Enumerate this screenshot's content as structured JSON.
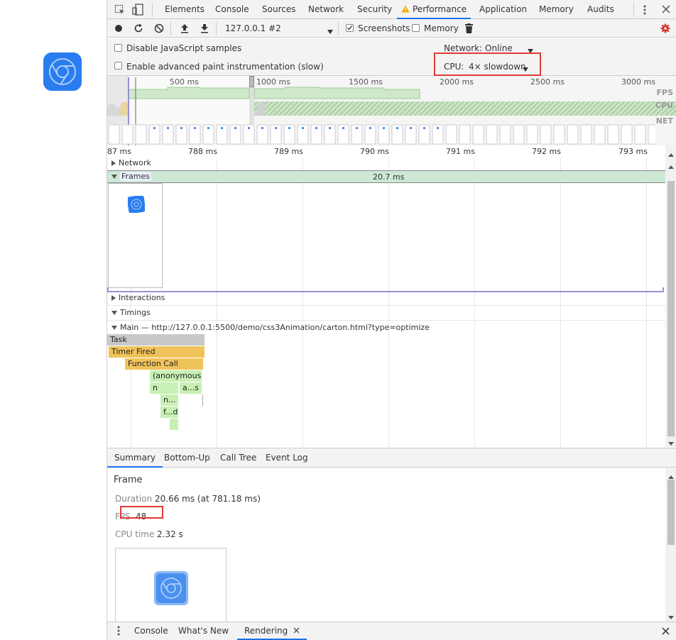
{
  "tabs": [
    "Elements",
    "Console",
    "Sources",
    "Network",
    "Security",
    "Performance",
    "Application",
    "Memory",
    "Audits"
  ],
  "active_tab": "Performance",
  "toolbar": {
    "profile_select": "127.0.0.1 #2",
    "screenshots_label": "Screenshots",
    "memory_label": "Memory"
  },
  "settings": {
    "disable_js_samples": "Disable JavaScript samples",
    "advanced_paint": "Enable advanced paint instrumentation (slow)",
    "network_label": "Network:",
    "network_value": "Online",
    "cpu_label": "CPU:",
    "cpu_value": "4× slowdown"
  },
  "overview": {
    "ticks": [
      "500 ms",
      "1000 ms",
      "1500 ms",
      "2000 ms",
      "2500 ms",
      "3000 ms"
    ],
    "labels": [
      "FPS",
      "CPU",
      "NET"
    ]
  },
  "ruler_ticks": [
    "87 ms",
    "788 ms",
    "789 ms",
    "790 ms",
    "791 ms",
    "792 ms",
    "793 ms"
  ],
  "tracks": {
    "network": "Network",
    "frames": "Frames",
    "frame_duration": "20.7 ms",
    "interactions": "Interactions",
    "timings": "Timings",
    "main": "Main — http://127.0.0.1:5500/demo/css3Animation/carton.html?type=optimize"
  },
  "flame": {
    "task": "Task",
    "timer_fired": "Timer Fired",
    "function_call": "Function Call",
    "anonymous": "(anonymous)",
    "n": "n",
    "as": "a...s",
    "n2": "n...",
    "fd": "f...d"
  },
  "detail_tabs": [
    "Summary",
    "Bottom-Up",
    "Call Tree",
    "Event Log"
  ],
  "summary": {
    "title": "Frame",
    "duration_key": "Duration",
    "duration_val": "20.66 ms (at 781.18 ms)",
    "fps_key": "FPS",
    "fps_val": "48",
    "cpu_key": "CPU time",
    "cpu_val": "2.32 s"
  },
  "drawer_tabs": [
    "Console",
    "What's New",
    "Rendering"
  ],
  "colors": {
    "accent": "#1a73e8",
    "highlight": "#e53935",
    "frame_green": "#cde8d4",
    "task_gray": "#c8c8c8",
    "timer_yellow": "#f0c35a",
    "function_yellow": "#f0c35a",
    "script_green": "#c8f0b4"
  }
}
